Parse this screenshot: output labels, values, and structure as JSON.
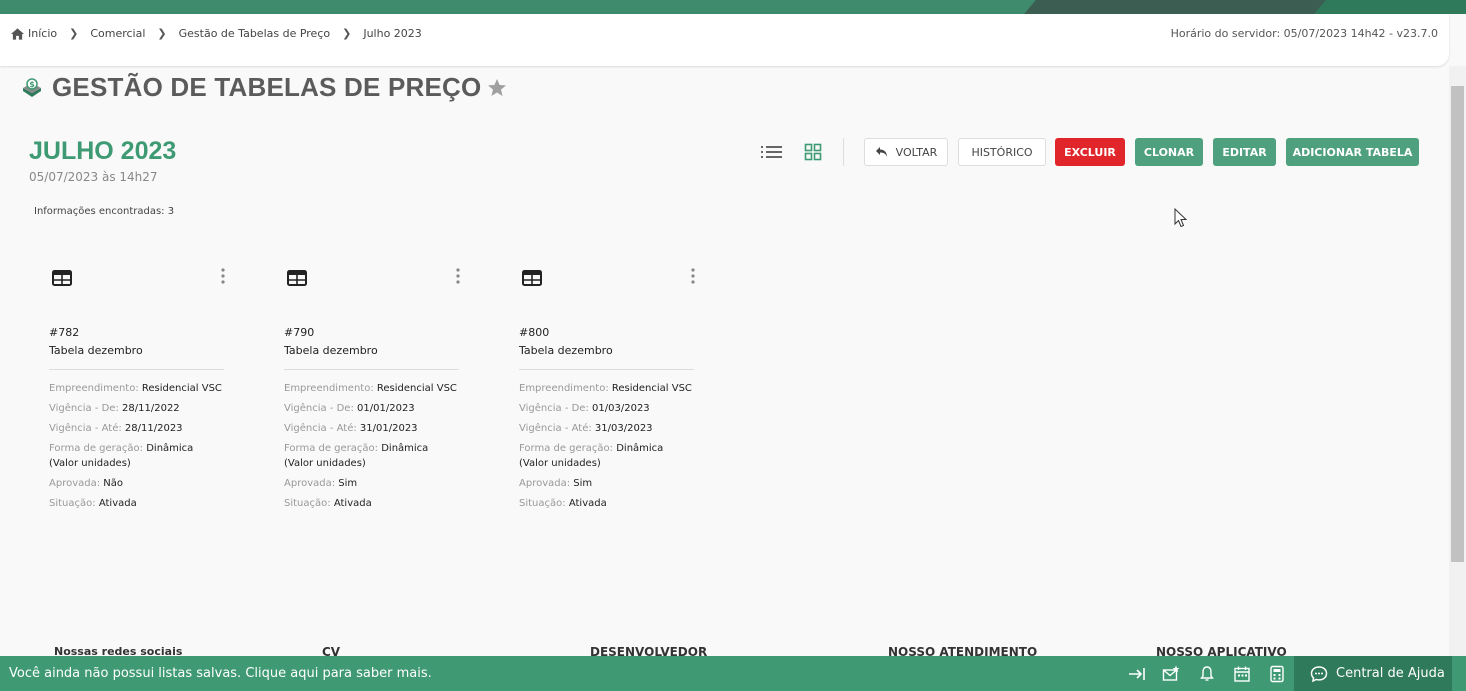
{
  "breadcrumb": {
    "items": [
      "Início",
      "Comercial",
      "Gestão de Tabelas de Preço",
      "Julho 2023"
    ]
  },
  "server_time": "Horário do servidor: 05/07/2023 14h42 - v23.7.0",
  "page": {
    "title": "GESTÃO DE TABELAS DE PREÇO",
    "subtitle": "JULHO 2023",
    "date": "05/07/2023 às 14h27",
    "found_label": "Informações encontradas:",
    "found_count": "3"
  },
  "toolbar": {
    "back": "VOLTAR",
    "history": "HISTÓRICO",
    "delete": "EXCLUIR",
    "clone": "CLONAR",
    "edit": "EDITAR",
    "add": "ADICIONAR TABELA"
  },
  "labels": {
    "empreendimento": "Empreendimento:",
    "vig_de": "Vigência - De:",
    "vig_ate": "Vigência - Até:",
    "forma": "Forma de geração:",
    "aprovada": "Aprovada:",
    "situacao": "Situação:"
  },
  "cards": [
    {
      "id": "#782",
      "name": "Tabela dezembro",
      "empreendimento": "Residencial VSC",
      "vig_de": "28/11/2022",
      "vig_ate": "28/11/2023",
      "forma": "Dinâmica",
      "forma_extra": "(Valor unidades)",
      "aprovada": "Não",
      "situacao": "Ativada"
    },
    {
      "id": "#790",
      "name": "Tabela dezembro",
      "empreendimento": "Residencial VSC",
      "vig_de": "01/01/2023",
      "vig_ate": "31/01/2023",
      "forma": "Dinâmica",
      "forma_extra": "(Valor unidades)",
      "aprovada": "Sim",
      "situacao": "Ativada"
    },
    {
      "id": "#800",
      "name": "Tabela dezembro",
      "empreendimento": "Residencial VSC",
      "vig_de": "01/03/2023",
      "vig_ate": "31/03/2023",
      "forma": "Dinâmica",
      "forma_extra": "(Valor unidades)",
      "aprovada": "Sim",
      "situacao": "Ativada"
    }
  ],
  "footer": {
    "headings": [
      "Nossas redes sociais",
      "CV",
      "DESENVOLVEDOR",
      "NOSSO ATENDIMENTO",
      "NOSSO APLICATIVO"
    ]
  },
  "bottombar": {
    "message": "Você ainda não possui listas salvas. Clique aqui para saber mais.",
    "help": "Central de Ajuda"
  },
  "colors": {
    "brand_green": "#3f9a73",
    "danger_red": "#e0262a"
  }
}
